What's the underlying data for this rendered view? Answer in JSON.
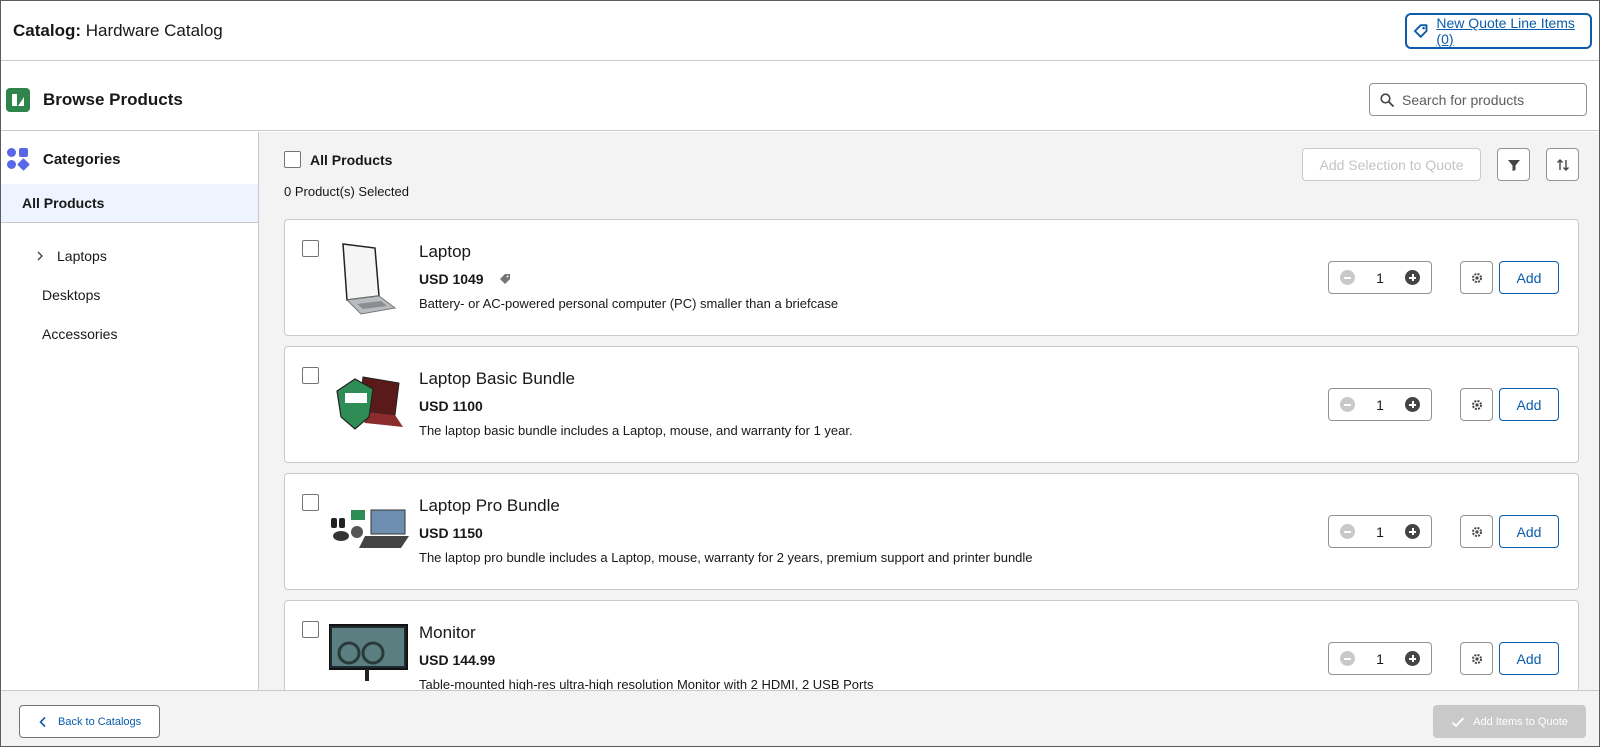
{
  "header": {
    "catalog_prefix": "Catalog:",
    "catalog_name": "Hardware Catalog",
    "quote_items_label": "New Quote Line Items (0)"
  },
  "browse": {
    "title": "Browse Products",
    "search_placeholder": "Search for products"
  },
  "sidebar": {
    "title": "Categories",
    "selected": "All Products",
    "items": [
      {
        "label": "Laptops",
        "expandable": true
      },
      {
        "label": "Desktops"
      },
      {
        "label": "Accessories"
      }
    ]
  },
  "toolbar": {
    "all_label": "All Products",
    "selected_count": "0 Product(s) Selected",
    "add_selection_label": "Add Selection to Quote",
    "filter_icon": "filter-icon",
    "sort_icon": "sort-icon"
  },
  "products": [
    {
      "name": "Laptop",
      "price": "USD 1049",
      "has_tag": true,
      "description": "Battery- or AC-powered personal computer (PC) smaller than a briefcase",
      "quantity": "1",
      "add_label": "Add"
    },
    {
      "name": "Laptop Basic Bundle",
      "price": "USD 1100",
      "has_tag": false,
      "description": "The laptop basic bundle includes a Laptop, mouse, and warranty for 1 year.",
      "quantity": "1",
      "add_label": "Add"
    },
    {
      "name": "Laptop Pro Bundle",
      "price": "USD 1150",
      "has_tag": false,
      "description": "The laptop pro bundle includes a Laptop, mouse, warranty for 2 years, premium support and printer bundle",
      "quantity": "1",
      "add_label": "Add"
    },
    {
      "name": "Monitor",
      "price": "USD 144.99",
      "has_tag": false,
      "description": "Table-mounted high-res ultra-high resolution Monitor with 2 HDMI, 2 USB Ports",
      "quantity": "1",
      "add_label": "Add"
    }
  ],
  "footer": {
    "back_label": "Back to Catalogs",
    "add_items_label": "Add Items to Quote"
  },
  "colors": {
    "brand_blue": "#0b5cab",
    "browse_icon_green": "#2e844a",
    "category_icon_purple": "#5867e8",
    "selected_bg": "#eef4ff"
  }
}
